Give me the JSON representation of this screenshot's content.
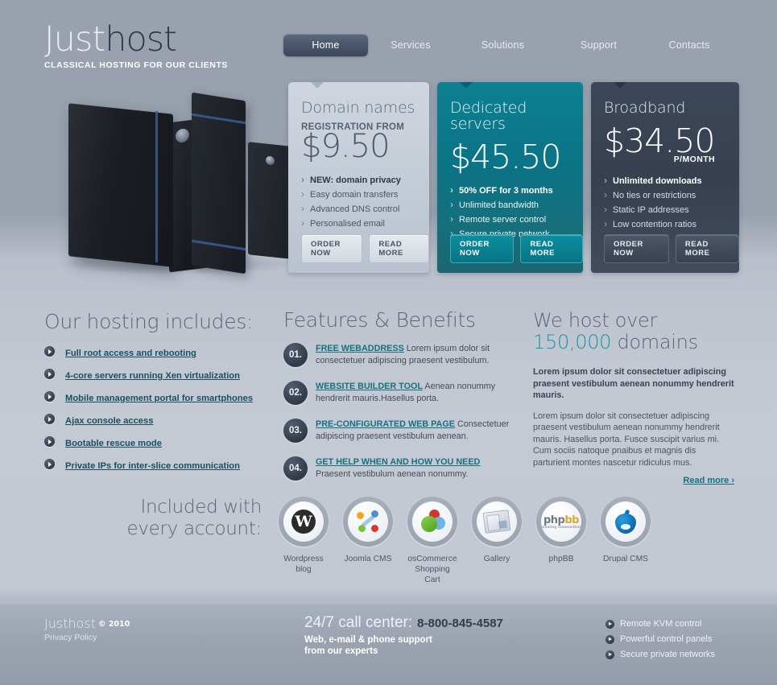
{
  "brand": {
    "logo_just": "Just",
    "logo_host": "host",
    "tagline": "CLASSICAL HOSTING FOR OUR CLIENTS"
  },
  "nav": {
    "items": [
      {
        "label": "Home",
        "active": true
      },
      {
        "label": "Services",
        "active": false
      },
      {
        "label": "Solutions",
        "active": false
      },
      {
        "label": "Support",
        "active": false
      },
      {
        "label": "Contacts",
        "active": false
      }
    ]
  },
  "cards": [
    {
      "title": "Domain names",
      "subtitle": "REGISTRATION FROM",
      "price": "$9.50",
      "per": "",
      "features": [
        {
          "text": "NEW: domain privacy",
          "bold": true
        },
        {
          "text": "Easy domain transfers",
          "bold": false
        },
        {
          "text": "Advanced DNS control",
          "bold": false
        },
        {
          "text": "Personalised email",
          "bold": false
        }
      ],
      "order_label": "ORDER NOW",
      "read_label": "READ MORE",
      "accent": "#c3cbd6"
    },
    {
      "title_l1": "Dedicated",
      "title_l2": "servers",
      "title": "Dedicated servers",
      "subtitle": "",
      "price": "$45.50",
      "per": "",
      "features": [
        {
          "text": "50% OFF for 3 months",
          "bold": true
        },
        {
          "text": "Unlimited bandwidth",
          "bold": false
        },
        {
          "text": "Remote server control",
          "bold": false
        },
        {
          "text": "Secure private network",
          "bold": false
        }
      ],
      "order_label": "ORDER NOW",
      "read_label": "READ MORE",
      "accent": "#0b7386"
    },
    {
      "title": "Broadband",
      "subtitle": "",
      "price": "$34.50",
      "per": "P/MONTH",
      "features": [
        {
          "text": "Unlimited downloads",
          "bold": true
        },
        {
          "text": "No ties or restrictions",
          "bold": false
        },
        {
          "text": "Static IP addresses",
          "bold": false
        },
        {
          "text": "Low contention ratios",
          "bold": false
        }
      ],
      "order_label": "ORDER NOW",
      "read_label": "READ MORE",
      "accent": "#3c4759"
    }
  ],
  "hosting": {
    "heading": "Our hosting includes:",
    "items": [
      "Full root access and rebooting",
      "4-core servers running Xen virtualization",
      "Mobile management portal for smartphones",
      "Ajax console access",
      "Bootable rescue mode",
      "Private IPs for inter-slice communication"
    ]
  },
  "features": {
    "heading": "Features & Benefits",
    "items": [
      {
        "num": "01.",
        "link": "FREE WEBADDRESS",
        "text": " Lorem ipsum dolor sit consectetuer adipiscing praesent vestibulum."
      },
      {
        "num": "02.",
        "link": "WEBSITE BUILDER TOOL",
        "text": "  Aenean nonummy hendrerit mauris.Hasellus porta."
      },
      {
        "num": "03.",
        "link": "PRE-CONFIGURATED WEB PAGE",
        "text": " Consectetuer adipiscing praesent vestibulum aenean."
      },
      {
        "num": "04.",
        "link": "GET HELP WHEN AND HOW YOU NEED",
        "text": " Praesent vestibulum aenean nonummy."
      }
    ]
  },
  "host_over": {
    "heading_pre": "We host over ",
    "heading_num": "150,000",
    "heading_post": " domains",
    "lead": "Lorem ipsum dolor sit consectetuer adipiscing praesent vestibulum aenean nonummy hendrerit mauris.",
    "body": "Lorem ipsum dolor sit consectetuer adipiscing praesent vestibulum aenean nonummy hendrerit mauris. Hasellus porta. Fusce suscipit varius mi. Cum sociis natoque pnaibus et magnis dis parturient montes nascetur ridiculus mus.",
    "read_more": "Read more ›"
  },
  "included": {
    "heading": "Included with every account:",
    "apps": [
      {
        "label": "Wordpress blog",
        "icon": "wordpress-icon"
      },
      {
        "label": "Joomla CMS",
        "icon": "joomla-icon"
      },
      {
        "label": "osCommerce Shopping Cart",
        "icon": "oscommerce-icon"
      },
      {
        "label": "Gallery",
        "icon": "gallery-icon"
      },
      {
        "label": "phpBB",
        "icon": "phpbb-icon"
      },
      {
        "label": "Drupal CMS",
        "icon": "drupal-icon"
      }
    ]
  },
  "footer": {
    "logo": "Justhost",
    "copyright": "© 2010",
    "privacy": "Privacy Policy",
    "call_center": "24/7 call center:",
    "phone": "8-800-845-4587",
    "support_l1": "Web, e-mail & phone support",
    "support_l2": "from our experts",
    "links": [
      "Remote KVM control",
      "Powerful control panels",
      "Secure private networks"
    ]
  }
}
